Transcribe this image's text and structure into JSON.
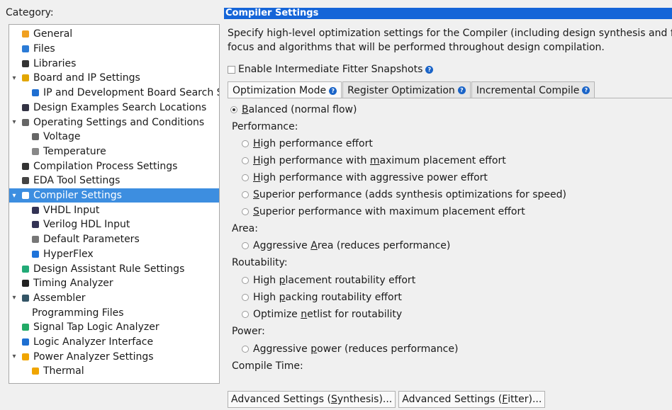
{
  "category_label": "Category:",
  "tree": [
    {
      "label": "General",
      "icon": "general-icon",
      "depth": 1
    },
    {
      "label": "Files",
      "icon": "file-icon",
      "depth": 1
    },
    {
      "label": "Libraries",
      "icon": "folder-icon",
      "depth": 1
    },
    {
      "label": "Board and IP Settings",
      "icon": "board-icon",
      "depth": 1,
      "expander": "▾"
    },
    {
      "label": "IP and Development Board Search Se",
      "icon": "ip-board-icon",
      "depth": 2
    },
    {
      "label": "Design Examples Search Locations",
      "icon": "design-examples-icon",
      "depth": 1
    },
    {
      "label": "Operating Settings and Conditions",
      "icon": "operating-icon",
      "depth": 1,
      "expander": "▾"
    },
    {
      "label": "Voltage",
      "icon": "voltage-icon",
      "depth": 2
    },
    {
      "label": "Temperature",
      "icon": "temperature-icon",
      "depth": 2
    },
    {
      "label": "Compilation Process Settings",
      "icon": "compilation-icon",
      "depth": 1
    },
    {
      "label": "EDA Tool Settings",
      "icon": "eda-icon",
      "depth": 1
    },
    {
      "label": "Compiler Settings",
      "icon": "compiler-icon",
      "depth": 1,
      "expander": "▾",
      "selected": true
    },
    {
      "label": "VHDL Input",
      "icon": "vhdl-icon",
      "depth": 2
    },
    {
      "label": "Verilog HDL Input",
      "icon": "verilog-icon",
      "depth": 2
    },
    {
      "label": "Default Parameters",
      "icon": "parameters-icon",
      "depth": 2
    },
    {
      "label": "HyperFlex",
      "icon": "hyperflex-icon",
      "depth": 2
    },
    {
      "label": "Design Assistant Rule Settings",
      "icon": "design-assistant-icon",
      "depth": 1
    },
    {
      "label": "Timing Analyzer",
      "icon": "timing-icon",
      "depth": 1
    },
    {
      "label": "Assembler",
      "icon": "assembler-icon",
      "depth": 1,
      "expander": "▾"
    },
    {
      "label": "Programming Files",
      "icon": "",
      "depth": 2
    },
    {
      "label": "Signal Tap Logic Analyzer",
      "icon": "signal-tap-icon",
      "depth": 1
    },
    {
      "label": "Logic Analyzer Interface",
      "icon": "logic-analyzer-icon",
      "depth": 1
    },
    {
      "label": "Power Analyzer Settings",
      "icon": "power-icon",
      "depth": 1,
      "expander": "▾"
    },
    {
      "label": "Thermal",
      "icon": "thermal-icon",
      "depth": 2
    }
  ],
  "panel": {
    "title": "Compiler Settings",
    "description_line1": "Specify high-level optimization settings for the Compiler (including design synthesis and fitting",
    "description_line2": "focus and algorithms that will be performed throughout design compilation.",
    "snapshot_checkbox_label": "Enable Intermediate Fitter Snapshots"
  },
  "tabs": [
    {
      "label": "Optimization Mode",
      "active": true
    },
    {
      "label": "Register Optimization",
      "active": false
    },
    {
      "label": "Incremental Compile",
      "active": false
    }
  ],
  "options": {
    "balanced_prefix": "",
    "balanced_u": "B",
    "balanced_suffix": "alanced (normal flow)",
    "performance_label": "Performance:",
    "perf1": "igh performance effort",
    "perf2_a": "igh performance with ",
    "perf2_b": "aximum placement effort",
    "perf3": "igh performance with aggressive power effort",
    "perf4": "uperior performance (adds synthesis optimizations for speed)",
    "perf5": "uperior performance with maximum placement effort",
    "area_label": "Area:",
    "area1_a": "Aggressive ",
    "area1_b": "rea (reduces performance)",
    "routability_label": "Routability:",
    "route1_a": "High ",
    "route1_b": "lacement routability effort",
    "route2_a": "High ",
    "route2_b": "acking routability effort",
    "route3_a": "Optimize ",
    "route3_b": "etlist for routability",
    "power_label": "Power:",
    "power1_a": "Aggressive ",
    "power1_b": "ower (reduces performance)",
    "compile_time_label": "Compile Time:"
  },
  "buttons": {
    "synthesis_a": "Advanced Settings (",
    "synthesis_b": "ynthesis)...",
    "fitter_a": "Advanced Settings (",
    "fitter_b": "itter)..."
  }
}
